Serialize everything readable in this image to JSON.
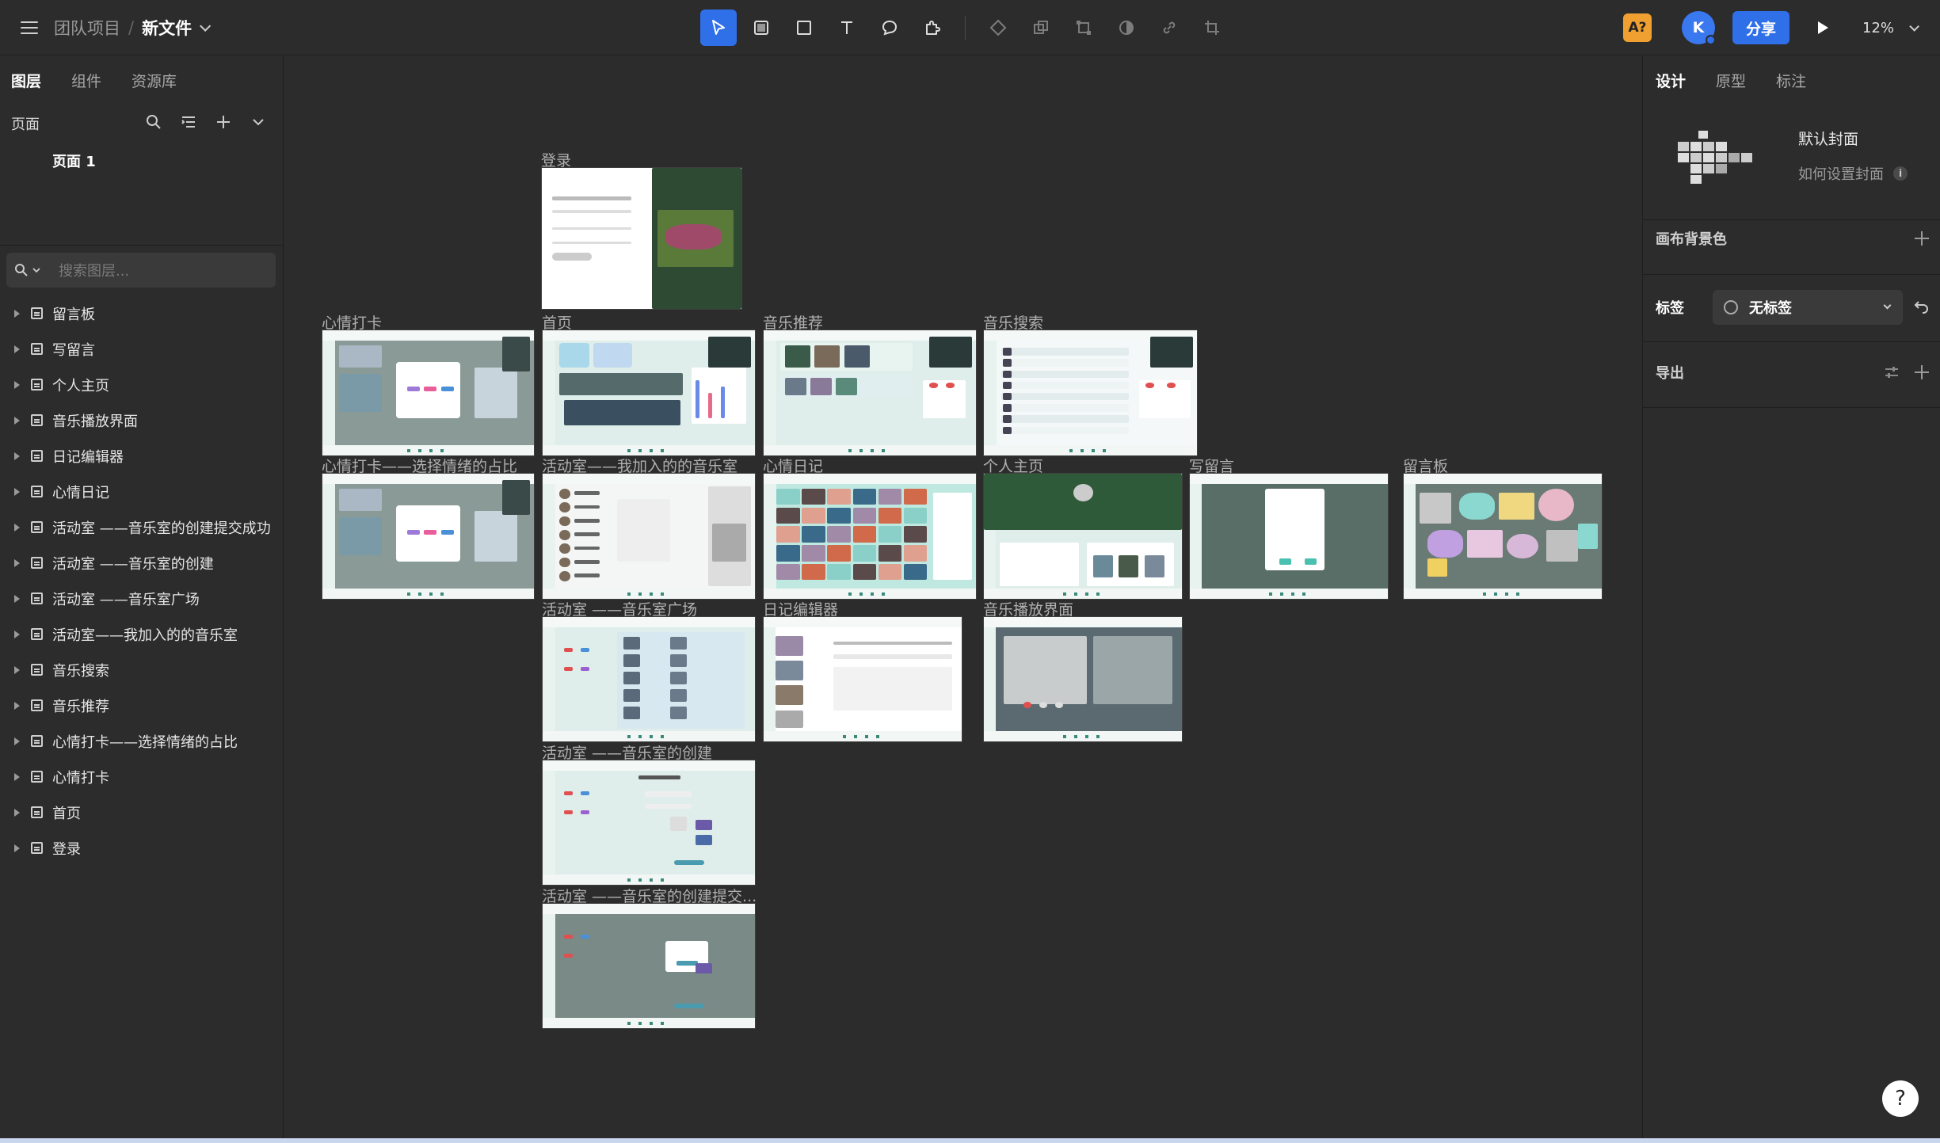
{
  "header": {
    "team": "团队项目",
    "separator": "/",
    "file_name": "新文件",
    "ai_badge": "A?",
    "avatar_initial": "K",
    "share_label": "分享",
    "zoom": "12%"
  },
  "toolbar": {
    "tools": [
      "move-tool",
      "frame-tool",
      "rectangle-tool",
      "text-tool",
      "comment-tool",
      "plugin-tool",
      "component-tool",
      "boolean-tool",
      "transform-tool",
      "mask-tool",
      "link-tool",
      "crop-tool"
    ]
  },
  "left_panel": {
    "tabs": [
      "图层",
      "组件",
      "资源库"
    ],
    "pages_title": "页面",
    "current_page": "页面 1",
    "search_placeholder": "搜索图层...",
    "layers": [
      "留言板",
      "写留言",
      "个人主页",
      "音乐播放界面",
      "日记编辑器",
      "心情日记",
      "活动室 ——音乐室的创建提交成功",
      "活动室 ——音乐室的创建",
      "活动室 ——音乐室广场",
      "活动室——我加入的的音乐室",
      "音乐搜索",
      "音乐推荐",
      "心情打卡——选择情绪的占比",
      "心情打卡",
      "首页",
      "登录"
    ]
  },
  "canvas": {
    "frames": [
      {
        "label": "登录"
      },
      {
        "label": "心情打卡"
      },
      {
        "label": "首页"
      },
      {
        "label": "音乐推荐"
      },
      {
        "label": "音乐搜索"
      },
      {
        "label": "心情打卡——选择情绪的占比"
      },
      {
        "label": "活动室——我加入的的音乐室"
      },
      {
        "label": "心情日记"
      },
      {
        "label": "个人主页"
      },
      {
        "label": "写留言"
      },
      {
        "label": "留言板"
      },
      {
        "label": "活动室 ——音乐室广场"
      },
      {
        "label": "日记编辑器"
      },
      {
        "label": "音乐播放界面"
      },
      {
        "label": "活动室 ——音乐室的创建"
      },
      {
        "label": "活动室 ——音乐室的创建提交..."
      }
    ]
  },
  "right_panel": {
    "tabs": [
      "设计",
      "原型",
      "标注"
    ],
    "cover_title": "默认封面",
    "cover_link": "如何设置封面",
    "canvas_bg_label": "画布背景色",
    "tag_label": "标签",
    "tag_value": "无标签",
    "export_label": "导出"
  },
  "help_label": "?",
  "colors": {
    "accent": "#2f6fe8",
    "panel_bg": "#2c2c2c",
    "ai_badge": "#f0a030"
  }
}
